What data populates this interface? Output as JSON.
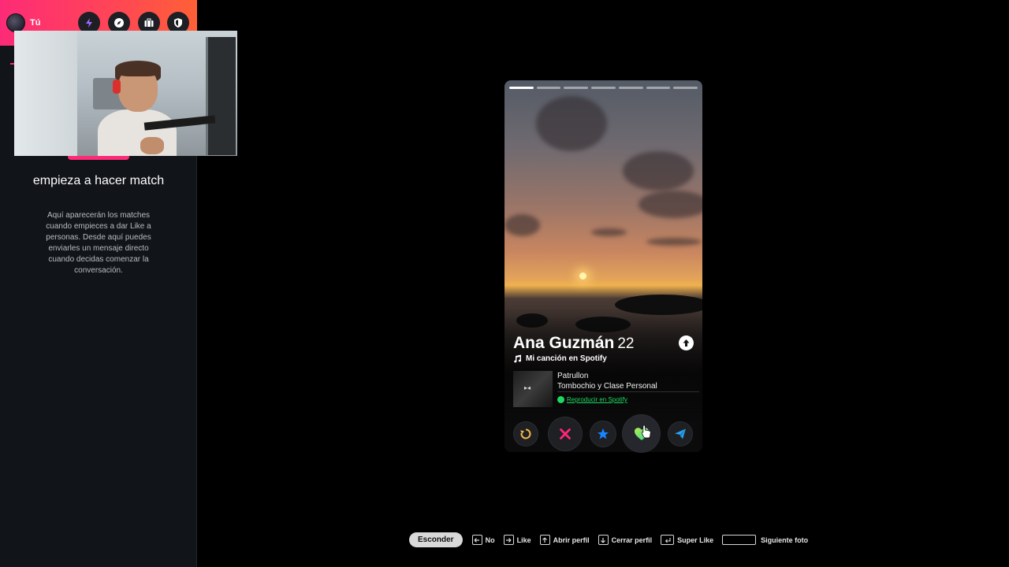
{
  "sidebar": {
    "user_name": "Tú",
    "header_buttons": [
      "boost-icon",
      "explore-icon",
      "work-icon",
      "safety-icon"
    ],
    "empty_title": "empieza a hacer match",
    "empty_text": "Aquí aparecerán los matches cuando empieces a dar Like a personas. Desde aquí puedes enviarles un mensaje directo cuando decidas comenzar la conversación."
  },
  "card": {
    "name": "Ana Guzmán",
    "age": "22",
    "photo_count": 7,
    "active_photo": 1,
    "anthem_label": "Mi canción en Spotify",
    "song_title": "Patrullon",
    "song_artist": "Tombochio y Clase Personal",
    "spotify_link": "Reproducir en Spotify"
  },
  "actions": [
    "rewind-icon",
    "nope-icon",
    "super-like-icon",
    "like-icon",
    "boost-send-icon"
  ],
  "colors": {
    "brand_gradient_start": "#fd2b77",
    "brand_gradient_end": "#ff6036",
    "rewind": "#f5b748",
    "nope": "#fd267a",
    "super_like": "#1786ff",
    "like": "#4ee08f",
    "boost": "#2aa2f0",
    "spotify": "#1ed760"
  },
  "hints": {
    "hide": "Esconder",
    "nope": "No",
    "like": "Like",
    "open_profile": "Abrir perfil",
    "close_profile": "Cerrar perfil",
    "super_like": "Super Like",
    "next_photo": "Siguiente foto"
  }
}
